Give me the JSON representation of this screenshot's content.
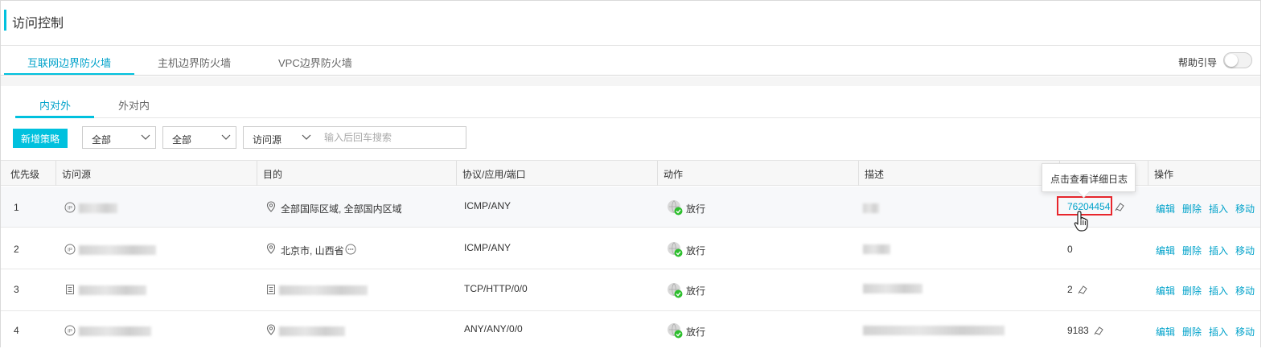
{
  "page": {
    "title": "访问控制"
  },
  "top_tabs": [
    "互联网边界防火墙",
    "主机边界防火墙",
    "VPC边界防火墙"
  ],
  "help": {
    "label": "帮助引导",
    "enabled": false
  },
  "sub_tabs": [
    "内对外",
    "外对内"
  ],
  "toolbar": {
    "new_button": "新增策略",
    "filter1": "全部",
    "filter2": "全部",
    "filter3": "访问源",
    "search_placeholder": "输入后回车搜索"
  },
  "table": {
    "columns": [
      "优先级",
      "访问源",
      "目的",
      "协议/应用/端口",
      "动作",
      "描述",
      "",
      "操作"
    ],
    "rows": [
      {
        "priority": "1",
        "dest": "全部国际区域, 全部国内区域",
        "protocol": "ICMP/ANY",
        "action": "放行",
        "hits": "76204454"
      },
      {
        "priority": "2",
        "dest": "北京市, 山西省",
        "protocol": "ICMP/ANY",
        "action": "放行",
        "hits": "0"
      },
      {
        "priority": "3",
        "dest": "",
        "protocol": "TCP/HTTP/0/0",
        "action": "放行",
        "hits": "2"
      },
      {
        "priority": "4",
        "dest": "",
        "protocol": "ANY/ANY/0/0",
        "action": "放行",
        "hits": "9183"
      }
    ],
    "ops": [
      "编辑",
      "删除",
      "插入",
      "移动"
    ]
  },
  "tooltip": "点击查看详细日志",
  "colors": {
    "accent": "#00c1de",
    "link": "#00a2ca",
    "highlight": "#e8262c",
    "allow": "#2ebf2e"
  }
}
